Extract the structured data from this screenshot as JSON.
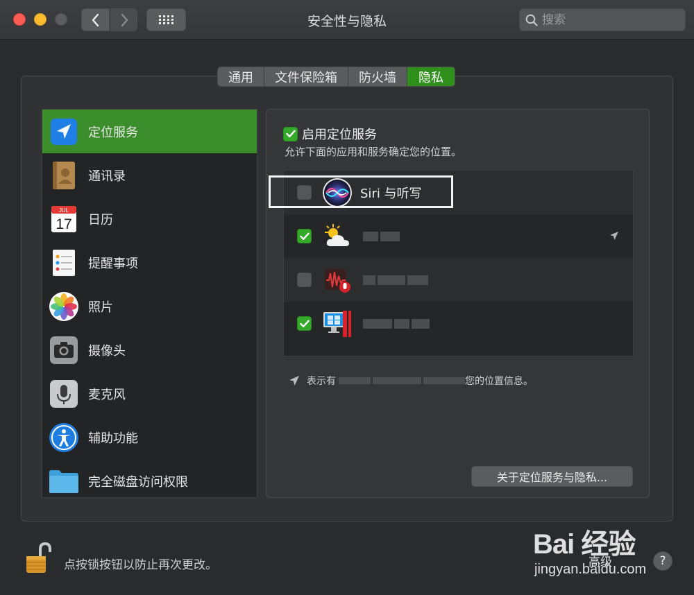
{
  "window": {
    "title": "安全性与隐私"
  },
  "search": {
    "placeholder": "搜索"
  },
  "tabs": [
    {
      "label": "通用",
      "active": false
    },
    {
      "label": "文件保险箱",
      "active": false
    },
    {
      "label": "防火墙",
      "active": false
    },
    {
      "label": "隐私",
      "active": true
    }
  ],
  "sidebar": {
    "items": [
      {
        "label": "定位服务",
        "icon": "location-icon",
        "selected": true
      },
      {
        "label": "通讯录",
        "icon": "contacts-icon",
        "selected": false
      },
      {
        "label": "日历",
        "icon": "calendar-icon",
        "selected": false,
        "icon_text": {
          "month": "JUL",
          "day": "17"
        }
      },
      {
        "label": "提醒事项",
        "icon": "reminders-icon",
        "selected": false
      },
      {
        "label": "照片",
        "icon": "photos-icon",
        "selected": false
      },
      {
        "label": "摄像头",
        "icon": "camera-icon",
        "selected": false
      },
      {
        "label": "麦克风",
        "icon": "microphone-icon",
        "selected": false
      },
      {
        "label": "辅助功能",
        "icon": "accessibility-icon",
        "selected": false
      },
      {
        "label": "完全磁盘访问权限",
        "icon": "folder-icon",
        "selected": false
      }
    ]
  },
  "location": {
    "enable_label": "启用定位服务",
    "enabled": true,
    "description": "允许下面的应用和服务确定您的位置。",
    "apps": [
      {
        "name": "Siri 与听写",
        "checked": false,
        "icon": "siri-icon"
      },
      {
        "name": "",
        "checked": true,
        "icon": "weather-icon",
        "recent": true
      },
      {
        "name": "",
        "checked": false,
        "icon": "voice-app-icon"
      },
      {
        "name": "",
        "checked": true,
        "icon": "desktop-app-icon"
      }
    ],
    "note_visible_start": "表示有",
    "note_visible_end": "您的位置信息。",
    "about_button": "关于定位服务与隐私..."
  },
  "footer": {
    "lock_text": "点按锁按钮以防止再次更改。",
    "advanced_button": "高级",
    "help_button": "?"
  },
  "watermark": {
    "main": "Bai 经验",
    "sub": "jingyan.baidu.com"
  },
  "colors": {
    "accent": "#3c8d2b",
    "tab_active": "#2f8f1b",
    "checkbox_on": "#35a92a"
  }
}
